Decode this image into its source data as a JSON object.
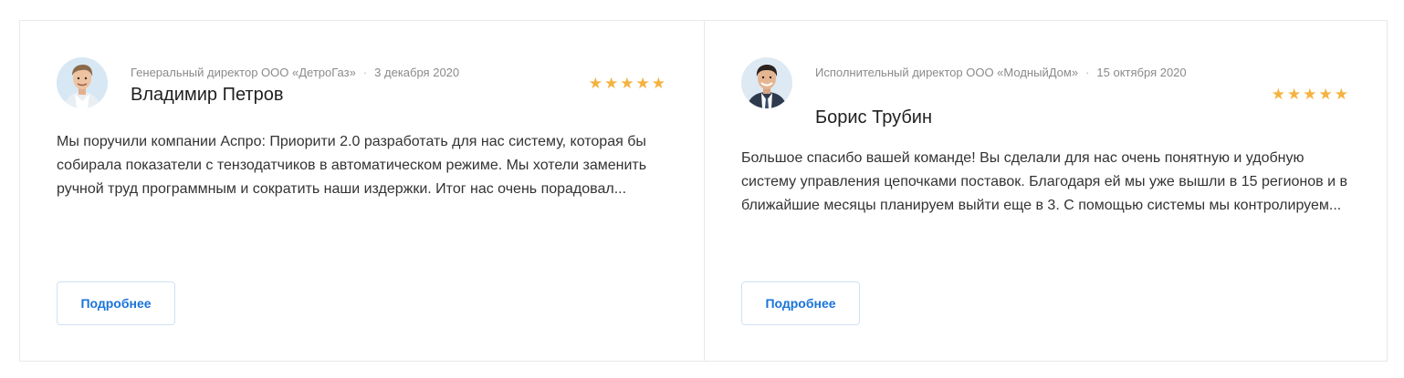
{
  "reviews": [
    {
      "position": "Генеральный директор ООО «ДетроГаз»",
      "date": "3 декабря 2020",
      "name": "Владимир Петров",
      "rating": 5,
      "stars": "★★★★★",
      "text": "Мы поручили компании Аспро: Приорити 2.0 разработать для нас систему, которая бы собирала показатели с тензодатчиков в автоматическом режиме. Мы хотели заменить ручной труд программным и сократить наши издержки. Итог нас очень порадовал...",
      "more_label": "Подробнее"
    },
    {
      "position": "Исполнительный директор ООО «МодныйДом»",
      "date": "15 октября 2020",
      "name": "Борис Трубин",
      "rating": 5,
      "stars": "★★★★★",
      "text": "Большое спасибо вашей команде! Вы сделали для нас очень понятную и удобную систему управления цепочками поставок. Благодаря ей мы уже вышли в 15 регионов и в ближайшие месяцы планируем выйти еще в 3. С помощью системы мы контролируем...",
      "more_label": "Подробнее"
    }
  ],
  "colors": {
    "accent": "#1a73d9",
    "star": "#f5b23f",
    "border": "#e8e8e8"
  },
  "icons": {
    "avatar_1": "person-avatar-photo",
    "avatar_2": "person-avatar-photo"
  }
}
